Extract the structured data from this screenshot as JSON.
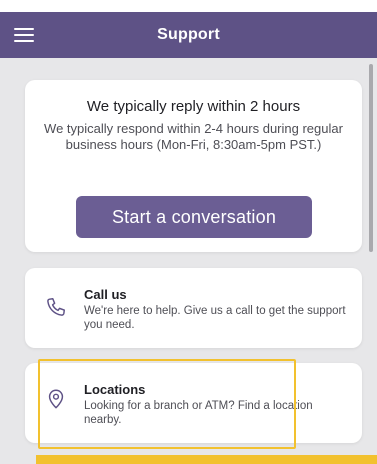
{
  "header": {
    "title": "Support",
    "menu_icon": "hamburger-menu-icon",
    "background": "#5e5286"
  },
  "reply_card": {
    "title": "We typically reply within 2 hours",
    "description": "We typically respond within 2-4 hours during regular business hours (Mon-Fri, 8:30am-5pm PST.)",
    "button_label": "Start a conversation",
    "button_color": "#6b5e94"
  },
  "options": [
    {
      "title": "Call us",
      "description": "We're here to help. Give us a call to get the support you need.",
      "icon": "phone-icon"
    },
    {
      "title": "Locations",
      "description": "Looking for a branch or ATM? Find a location nearby.",
      "icon": "location-pin-icon"
    }
  ],
  "highlight_color": "#f2c12e"
}
